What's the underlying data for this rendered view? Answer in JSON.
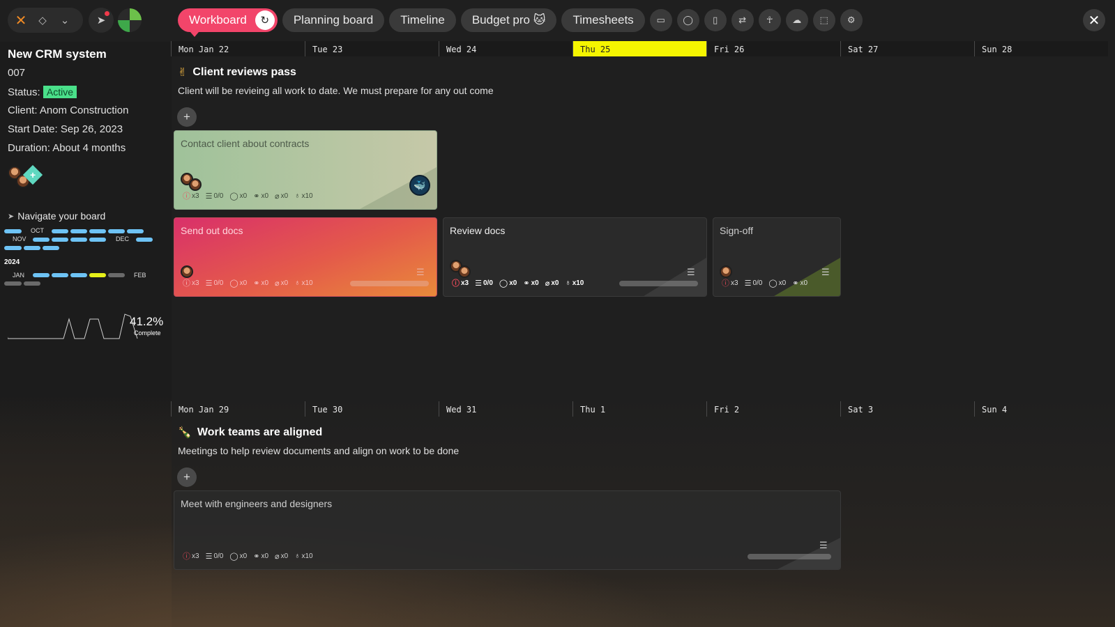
{
  "topbar": {
    "tabs": [
      {
        "label": "Workboard",
        "active": true
      },
      {
        "label": "Planning board"
      },
      {
        "label": "Timeline"
      },
      {
        "label": "Budget pro 🐱"
      },
      {
        "label": "Timesheets"
      }
    ],
    "tool_icons": [
      "chat-icon",
      "comment-icon",
      "document-icon",
      "compare-icon",
      "accessibility-icon",
      "cloud-icon",
      "select-icon",
      "gear-icon"
    ]
  },
  "project": {
    "title": "New CRM system",
    "code": "007",
    "status_label": "Status:",
    "status_value": "Active",
    "client": "Client: Anom Construction",
    "start_date": "Start Date: Sep 26, 2023",
    "duration": "Duration: About 4 months"
  },
  "navigator": {
    "title": "Navigate your board",
    "months": [
      "OCT",
      "NOV",
      "DEC",
      "JAN",
      "FEB"
    ],
    "year": "2024",
    "progress_pct": "41.2%",
    "progress_label": "Complete",
    "progress_value": 41.2
  },
  "weeks": [
    {
      "days": [
        "Mon Jan 22",
        "Tue 23",
        "Wed 24",
        "Thu 25",
        "Fri 26",
        "Sat 27",
        "Sun 28"
      ],
      "today_index": 3,
      "milestone": {
        "emoji": "✌",
        "title": "Client reviews pass",
        "description": "Client will be revieing all work to date. We must prepare for any out come"
      }
    },
    {
      "days": [
        "Mon Jan 29",
        "Tue 30",
        "Wed 31",
        "Thu 1",
        "Fri 2",
        "Sat 3",
        "Sun 4"
      ],
      "milestone": {
        "emoji": "🍾",
        "title": "Work teams are aligned",
        "description": "Meetings to help review documents and align on work to be done"
      }
    }
  ],
  "cards": [
    {
      "title": "Contact client about contracts",
      "stats": [
        "x3",
        "0/0",
        "x0",
        "x0",
        "x0",
        "x10"
      ]
    },
    {
      "title": "Send out docs",
      "stats": [
        "x3",
        "0/0",
        "x0",
        "x0",
        "x0",
        "x10"
      ]
    },
    {
      "title": "Review docs",
      "stats": [
        "x3",
        "0/0",
        "x0",
        "x0",
        "x0",
        "x10"
      ]
    },
    {
      "title": "Sign-off",
      "stats": [
        "x3",
        "0/0",
        "x0",
        "x0"
      ]
    },
    {
      "title": "Meet with engineers and designers",
      "stats": [
        "x3",
        "0/0",
        "x0",
        "x0",
        "x0",
        "x10"
      ]
    }
  ],
  "colors": {
    "accent": "#f2456a",
    "today": "#f5f500",
    "status_active": "#4ae08a",
    "calendar_pill": "#6ec3f5"
  }
}
